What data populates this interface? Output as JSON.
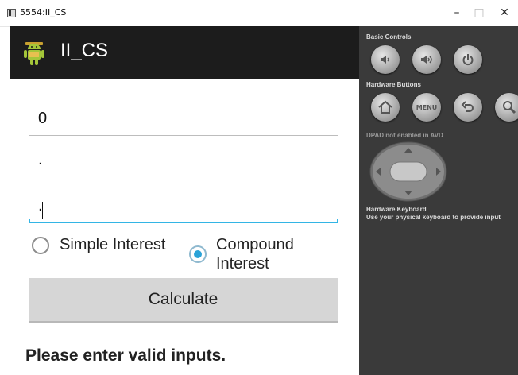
{
  "window": {
    "title": "5554:II_CS",
    "minimize": "–",
    "maximize": "□",
    "close": "✕"
  },
  "app": {
    "title": "II_CS",
    "fields": [
      "0",
      ".",
      "."
    ],
    "radios": [
      {
        "label": "Simple Interest",
        "checked": false
      },
      {
        "label": "Compound Interest",
        "label_line1": "Compound",
        "label_line2": "Interest",
        "checked": true
      }
    ],
    "calculate_label": "Calculate",
    "message": "Please enter valid inputs."
  },
  "panel": {
    "basic_controls": "Basic Controls",
    "hardware_buttons": "Hardware Buttons",
    "menu_label": "MENU",
    "dpad_note": "DPAD not enabled in AVD",
    "keyboard_title": "Hardware Keyboard",
    "keyboard_note": "Use your physical keyboard to provide input"
  },
  "colors": {
    "accent": "#33b5e5",
    "radio_fill": "#2aa3d8",
    "panel_bg": "#3a3a3a",
    "appbar_bg": "#1c1c1c",
    "android_green": "#a4c639"
  }
}
